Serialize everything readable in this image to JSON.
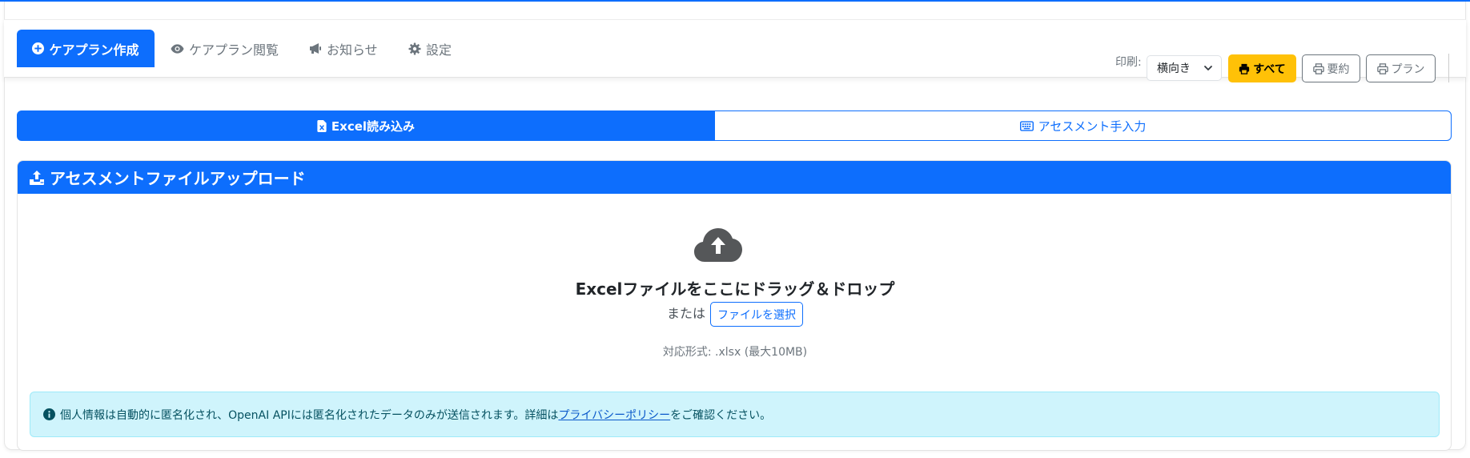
{
  "nav": {
    "tabs": [
      {
        "label": "ケアプラン作成",
        "icon": "plus-circle-icon",
        "active": true
      },
      {
        "label": "ケアプラン閲覧",
        "icon": "eye-icon",
        "active": false
      },
      {
        "label": "お知らせ",
        "icon": "megaphone-icon",
        "active": false
      },
      {
        "label": "設定",
        "icon": "gear-icon",
        "active": false
      }
    ],
    "print_label": "印刷:",
    "orientation_value": "横向き",
    "print_all_label": "すべて",
    "print_summary_label": "要約",
    "print_plan_label": "プラン"
  },
  "mode_toggle": {
    "excel_label": "Excel読み込み",
    "manual_label": "アセスメント手入力"
  },
  "upload_card": {
    "title": "アセスメントファイルアップロード",
    "drop_text": "Excelファイルをここにドラッグ＆ドロップ",
    "or_text": "または",
    "select_button_label": "ファイルを選択",
    "formats_text": "対応形式: .xlsx (最大10MB)"
  },
  "privacy_notice": {
    "text_before": "個人情報は自動的に匿名化され、OpenAI APIには匿名化されたデータのみが送信されます。詳細は",
    "link_text": "プライバシーポリシー",
    "text_after": "をご確認ください。"
  },
  "colors": {
    "primary": "#0d6efd",
    "warning": "#ffc107",
    "secondary": "#6c757d",
    "info_bg": "#cff4fc"
  }
}
